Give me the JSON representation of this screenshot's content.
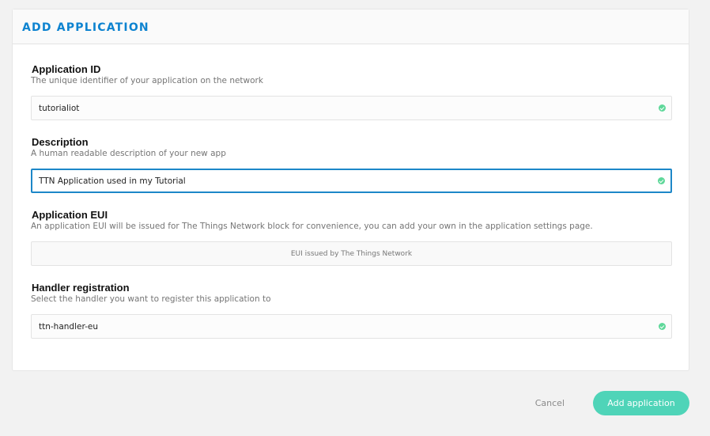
{
  "card": {
    "title": "ADD APPLICATION"
  },
  "fields": {
    "app_id": {
      "label": "Application ID",
      "description": "The unique identifier of your application on the network",
      "value": "tutorialiot"
    },
    "description": {
      "label": "Description",
      "description": "A human readable description of your new app",
      "value": "TTN Application used in my Tutorial"
    },
    "eui": {
      "label": "Application EUI",
      "description": "An application EUI will be issued for The Things Network block for convenience, you can add your own in the application settings page.",
      "value": "EUI issued by The Things Network"
    },
    "handler": {
      "label": "Handler registration",
      "description": "Select the handler you want to register this application to",
      "value": "ttn-handler-eu"
    }
  },
  "actions": {
    "cancel_label": "Cancel",
    "submit_label": "Add application"
  },
  "colors": {
    "title": "#0d83d0",
    "focus_border": "#1d87c8",
    "valid_check": "#5fd89a",
    "primary_button": "#4fd4b8",
    "background": "#f2f2f2"
  },
  "icons": {
    "valid": "check-circle-icon"
  }
}
